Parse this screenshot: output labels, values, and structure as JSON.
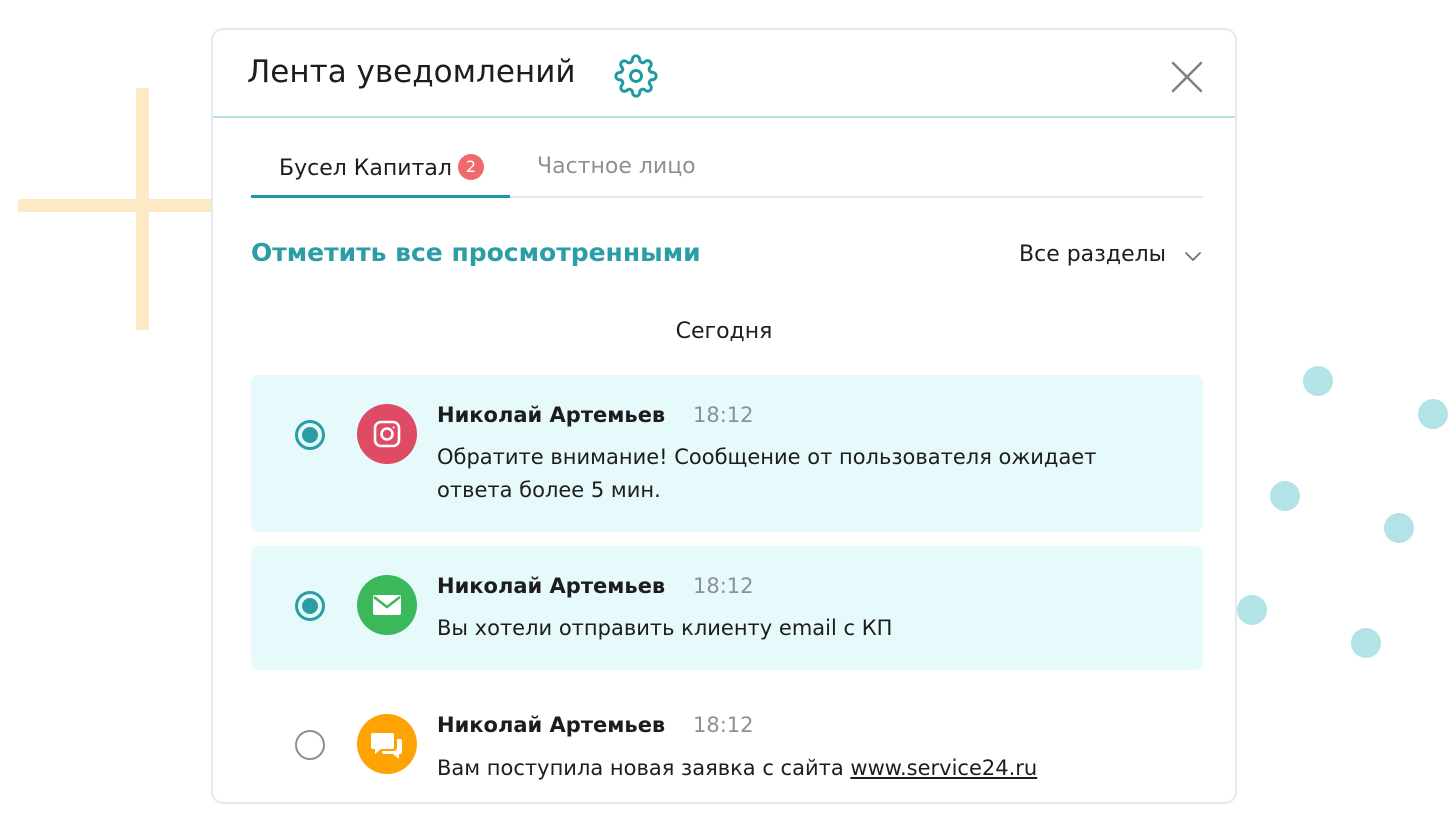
{
  "header": {
    "title": "Лента уведомлений",
    "settings_icon": "gear-icon",
    "close_icon": "close-icon"
  },
  "tabs": [
    {
      "label": "Бусел Капитал",
      "badge": "2",
      "active": true
    },
    {
      "label": "Частное лицо",
      "active": false
    }
  ],
  "toolbar": {
    "mark_all": "Отметить все просмотренными",
    "filter_value": "Все разделы",
    "filter_icon": "chevron-down-icon"
  },
  "date_group": "Сегодня",
  "notifications": [
    {
      "sender": "Николай Артемьев",
      "time": "18:12",
      "text": "Обратите внимание! Сообщение от пользователя ожидает ответа более 5 мин.",
      "channel_icon": "instagram-icon",
      "unread": true
    },
    {
      "sender": "Николай Артемьев",
      "time": "18:12",
      "text": "Вы хотели отправить клиенту email с КП",
      "channel_icon": "mail-icon",
      "unread": true
    },
    {
      "sender": "Николай Артемьев",
      "time": "18:12",
      "text": "Вам поступила новая заявка с сайта ",
      "link": "www.service24.ru",
      "channel_icon": "chat-icon",
      "unread": false
    }
  ],
  "colors": {
    "accent": "#2a9da5",
    "badge": "#ef6b6b",
    "unread_bg": "#e6fafc",
    "instagram": "#df4a64",
    "mail": "#3bb85a",
    "chat": "#ffa305",
    "decor_cross": "#fde9c4",
    "decor_dots": "#b2e4e7"
  }
}
